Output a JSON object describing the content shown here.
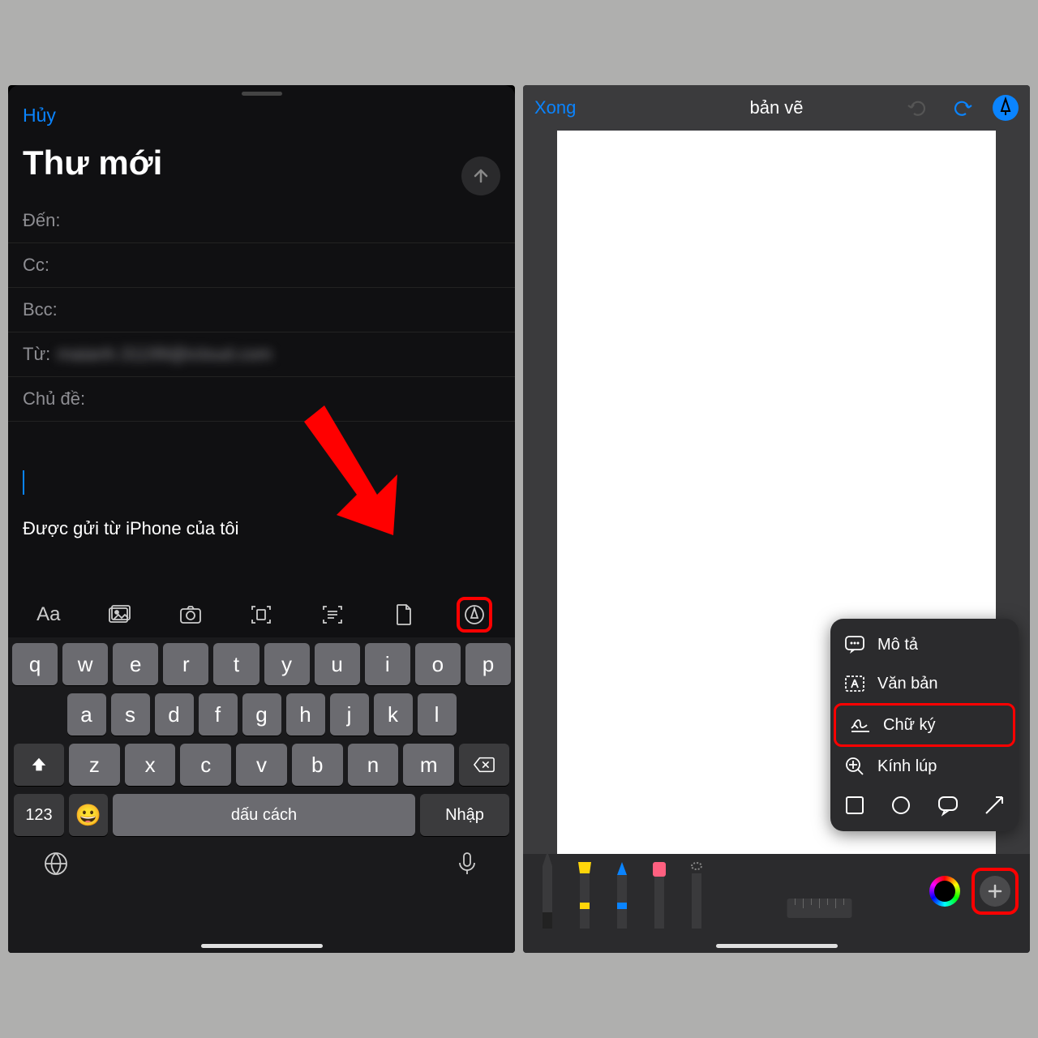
{
  "left": {
    "cancel": "Hủy",
    "title": "Thư mới",
    "fields": {
      "to": "Đến:",
      "cc": "Cc:",
      "bcc": "Bcc:",
      "from": "Từ:",
      "from_value": "maianh.31199@icloud.com",
      "subject": "Chủ đề:"
    },
    "signature": "Được gửi từ iPhone của tôi",
    "toolbar": {
      "text_format": "Aa"
    },
    "keyboard": {
      "row1": [
        "q",
        "w",
        "e",
        "r",
        "t",
        "y",
        "u",
        "i",
        "o",
        "p"
      ],
      "row2": [
        "a",
        "s",
        "d",
        "f",
        "g",
        "h",
        "j",
        "k",
        "l"
      ],
      "row3": [
        "z",
        "x",
        "c",
        "v",
        "b",
        "n",
        "m"
      ],
      "numbers": "123",
      "space": "dấu cách",
      "enter": "Nhập"
    }
  },
  "right": {
    "done": "Xong",
    "title": "bản vẽ",
    "popup": {
      "describe": "Mô tả",
      "text": "Văn bản",
      "signature": "Chữ ký",
      "magnifier": "Kính lúp"
    }
  }
}
